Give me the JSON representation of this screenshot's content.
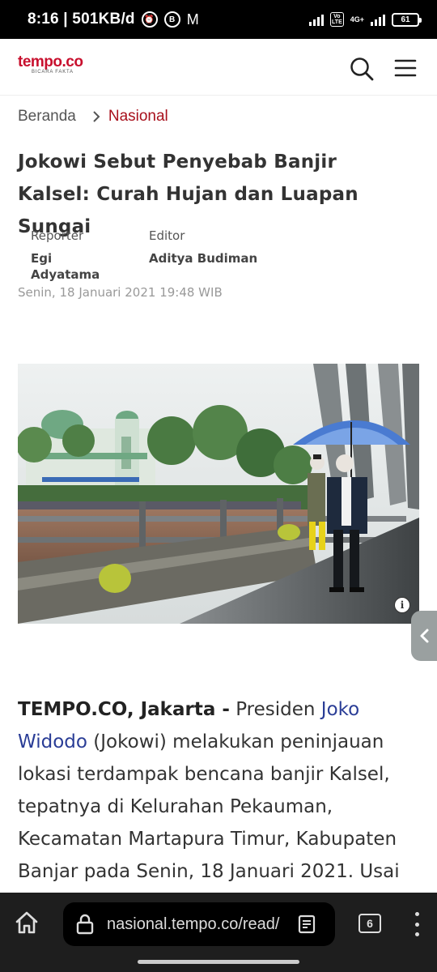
{
  "status_bar": {
    "time_speed": "8:16 | 501KB/d",
    "icons": [
      "alarm-icon",
      "b-icon",
      "gmail-icon",
      "signal-icon",
      "volte-icon",
      "4g-icon",
      "battery-icon"
    ],
    "volte": "Vo LTE",
    "network": "4G+",
    "battery": "61"
  },
  "header": {
    "logo": "tempo.co",
    "tagline": "BICARA FAKTA",
    "brand_color": "#c8102e"
  },
  "breadcrumb": {
    "home": "Beranda",
    "current": "Nasional"
  },
  "article": {
    "title": "Jokowi Sebut Penyebab Banjir Kalsel: Curah Hujan dan Luapan Sungai",
    "reporter_label": "Reporter",
    "reporter": "Egi Adyatama",
    "editor_label": "Editor",
    "editor": "Aditya Budiman",
    "date": "Senin, 18 Januari 2021 19:48 WIB",
    "dateline": "TEMPO.CO, Jakarta -",
    "body_before_link": " Presiden ",
    "link_text": "Joko Widodo",
    "body_after_link": " (Jokowi) melakukan peninjauan lokasi terdampak bencana banjir Kalsel, tepatnya di Kelurahan Pekauman, Kecamatan Martapura Timur, Kabupaten Banjar pada Senin, 18 Januari 2021. Usai",
    "info_glyph": "i",
    "link_color": "#2a3d96"
  },
  "browser": {
    "url": "nasional.tempo.co/read/",
    "tab_count": "6"
  }
}
